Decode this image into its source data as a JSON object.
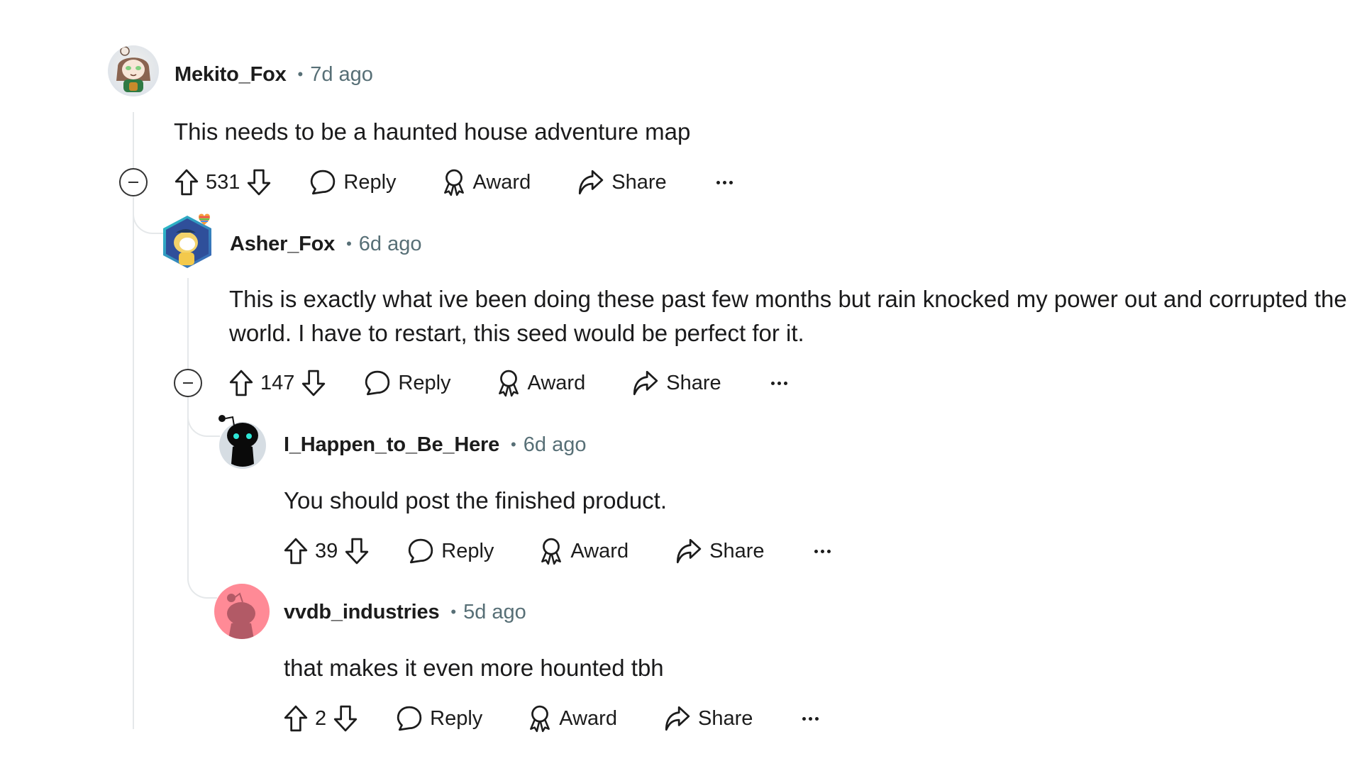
{
  "comments": [
    {
      "username": "Mekito_Fox",
      "separator": "•",
      "time": "7d ago",
      "body": "This needs to be a haunted house adventure map",
      "votes": "531",
      "avatar": "anime-girl-avatar",
      "collapsible": true
    },
    {
      "username": "Asher_Fox",
      "separator": "•",
      "time": "6d ago",
      "body": "This is exactly what ive been doing these past few months but rain knocked my power out and corrupted the world. I have to restart, this seed would be perfect for it.",
      "votes": "147",
      "avatar": "hexagon-snoo-avatar",
      "collapsible": true
    },
    {
      "username": "I_Happen_to_Be_Here",
      "separator": "•",
      "time": "6d ago",
      "body": "You should post the finished product.",
      "votes": "39",
      "avatar": "black-snoo-avatar",
      "collapsible": false
    },
    {
      "username": "vvdb_industries",
      "separator": "•",
      "time": "5d ago",
      "body": "that makes it even more hounted tbh",
      "votes": "2",
      "avatar": "default-pink-snoo-avatar",
      "collapsible": false
    }
  ],
  "actions": {
    "reply": "Reply",
    "award": "Award",
    "share": "Share"
  },
  "icons": {
    "upvote": "upvote-arrow-icon",
    "downvote": "downvote-arrow-icon",
    "reply": "speech-bubble-icon",
    "award": "award-ribbon-icon",
    "share": "share-arrow-icon",
    "more": "ellipsis-icon",
    "collapse": "collapse-minus-circle-icon"
  },
  "colors": {
    "text": "#1a1a1b",
    "meta": "#576f76",
    "thread_line": "#e5e8ea",
    "pink_avatar_bg": "#ff8a96",
    "pink_avatar_fg": "#b25a66"
  }
}
